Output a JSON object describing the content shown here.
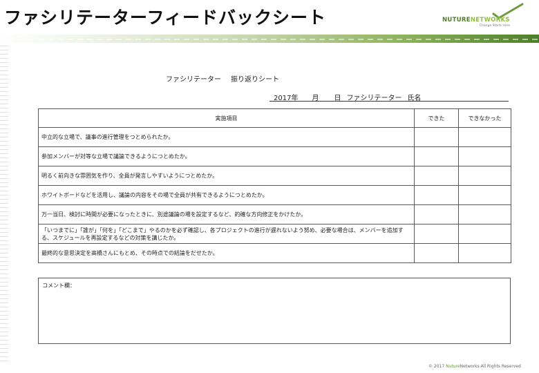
{
  "title": "ファシリテーターフィードバックシート",
  "logo": {
    "part1": "NUTURE",
    "part2": "NETWORKS",
    "tagline": "Change Starts Here",
    "check_color": "#6d9b3a",
    "icon": "checkmark-icon"
  },
  "sheet": {
    "heading_left": "ファシリテーター",
    "heading_right": "振り返りシート",
    "date_year": "2017年",
    "date_month": "月",
    "date_day": "日",
    "date_role": "ファシリテーター",
    "date_name": "氏名"
  },
  "table": {
    "headers": [
      "実施項目",
      "できた",
      "できなかった"
    ],
    "rows": [
      "中立的な立場で、議事の進行管理をつとめられたか。",
      "参加メンバーが対等な立場で議論できるようにつとめたか。",
      "明るく前向きな雰囲気を作り、全員が発言しやすいようにつとめたか。",
      "ホワイトボードなどを活用し、議論の内容をその場で全員が共有できるようにつとめたか。",
      "万一当日、検討に時間が必要になったときに、別途議論の場を設定するなど、的確な方向修正をかけたか。",
      "「いつまでに」「誰が」「何を」「どこまで」やるのかを必ず確認し、各プロジェクトの進行が遅れないよう努め、必要な場合は、メンバーを追加する、スケジュールを再設定するなどの対策を講じたか。",
      "最終的な意思決定を高橋さんにもとめ、その時点での結論をだせたか。"
    ]
  },
  "comment": {
    "label": "コメント欄："
  },
  "footer": {
    "pre": "© 2017 ",
    "brand": "Nuture",
    "post": "Networks All Rights Reserved"
  },
  "colors": {
    "accent": "#4d7f2a",
    "accent_light": "#8fbf3f"
  }
}
